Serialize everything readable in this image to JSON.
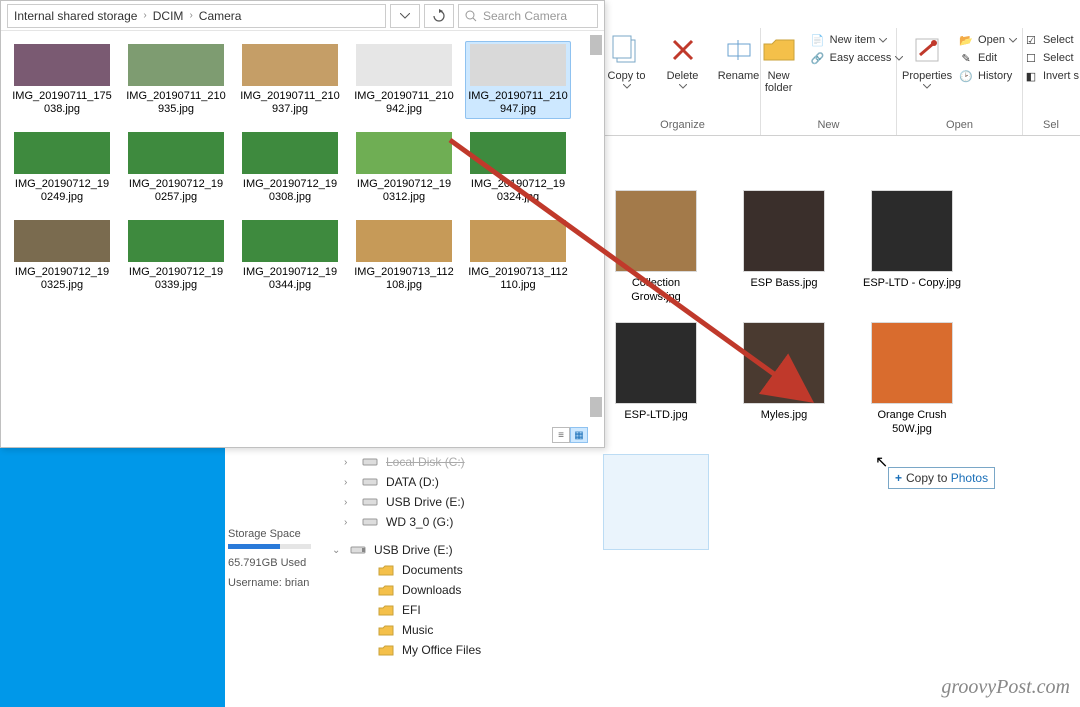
{
  "phone": {
    "breadcrumbs": [
      "Internal shared storage",
      "DCIM",
      "Camera"
    ],
    "search_placeholder": "Search Camera",
    "items": [
      {
        "name": "IMG_20190711_175038.jpg",
        "selected": false,
        "color": "#7a5a72"
      },
      {
        "name": "IMG_20190711_210935.jpg",
        "selected": false,
        "color": "#7e9c71"
      },
      {
        "name": "IMG_20190711_210937.jpg",
        "selected": false,
        "color": "#c59e67"
      },
      {
        "name": "IMG_20190711_210942.jpg",
        "selected": false,
        "color": "#e6e6e6"
      },
      {
        "name": "IMG_20190711_210947.jpg",
        "selected": true,
        "color": "#d9d9d9"
      },
      {
        "name": "IMG_20190712_190249.jpg",
        "selected": false,
        "color": "#3e8a3e"
      },
      {
        "name": "IMG_20190712_190257.jpg",
        "selected": false,
        "color": "#3e8a3e"
      },
      {
        "name": "IMG_20190712_190308.jpg",
        "selected": false,
        "color": "#3e8a3e"
      },
      {
        "name": "IMG_20190712_190312.jpg",
        "selected": false,
        "color": "#6fae54"
      },
      {
        "name": "IMG_20190712_190324.jpg",
        "selected": false,
        "color": "#3e8a3e"
      },
      {
        "name": "IMG_20190712_190325.jpg",
        "selected": false,
        "color": "#7a6b4f"
      },
      {
        "name": "IMG_20190712_190339.jpg",
        "selected": false,
        "color": "#3e8a3e"
      },
      {
        "name": "IMG_20190712_190344.jpg",
        "selected": false,
        "color": "#3e8a3e"
      },
      {
        "name": "IMG_20190713_112108.jpg",
        "selected": false,
        "color": "#c69a58"
      },
      {
        "name": "IMG_20190713_112110.jpg",
        "selected": false,
        "color": "#c69a58"
      }
    ]
  },
  "ribbon": {
    "groups": {
      "organize": {
        "title": "Organize",
        "copy_to": "Copy to",
        "delete": "Delete",
        "rename": "Rename"
      },
      "new": {
        "title": "New",
        "new_folder": "New folder",
        "new_item": "New item",
        "easy_access": "Easy access"
      },
      "open": {
        "title": "Open",
        "properties": "Properties",
        "open": "Open",
        "edit": "Edit",
        "history": "History"
      },
      "select": {
        "title": "Sel",
        "select_all": "Select",
        "select_none": "Select",
        "invert": "Invert s"
      }
    }
  },
  "right": {
    "items": [
      {
        "name": "Collection Grows.jpg",
        "color": "#a37a4a"
      },
      {
        "name": "ESP Bass.jpg",
        "color": "#3a2f2b"
      },
      {
        "name": "ESP-LTD - Copy.jpg",
        "color": "#2b2b2b"
      },
      {
        "name": "ESP-LTD.jpg",
        "color": "#2b2b2b"
      },
      {
        "name": "Myles.jpg",
        "color": "#4a3a30"
      },
      {
        "name": "Orange Crush 50W.jpg",
        "color": "#d96c2e"
      }
    ],
    "copy_tip_prefix": "Copy to ",
    "copy_tip_target": "Photos"
  },
  "navtree": {
    "drives_top": [
      {
        "name": "Local Disk (C:)",
        "icon": "drive",
        "strike": true
      },
      {
        "name": "DATA (D:)",
        "icon": "drive"
      },
      {
        "name": "USB Drive (E:)",
        "icon": "drive"
      },
      {
        "name": "WD 3_0 (G:)",
        "icon": "drive"
      }
    ],
    "usb_label": "USB Drive (E:)",
    "folders": [
      "Documents",
      "Downloads",
      "EFI",
      "Music",
      "My Office Files"
    ]
  },
  "info": {
    "storage_label": "Storage Space",
    "used_label": "65.791GB Used",
    "username_label": "Username: brian"
  },
  "watermark": "groovyPost.com"
}
